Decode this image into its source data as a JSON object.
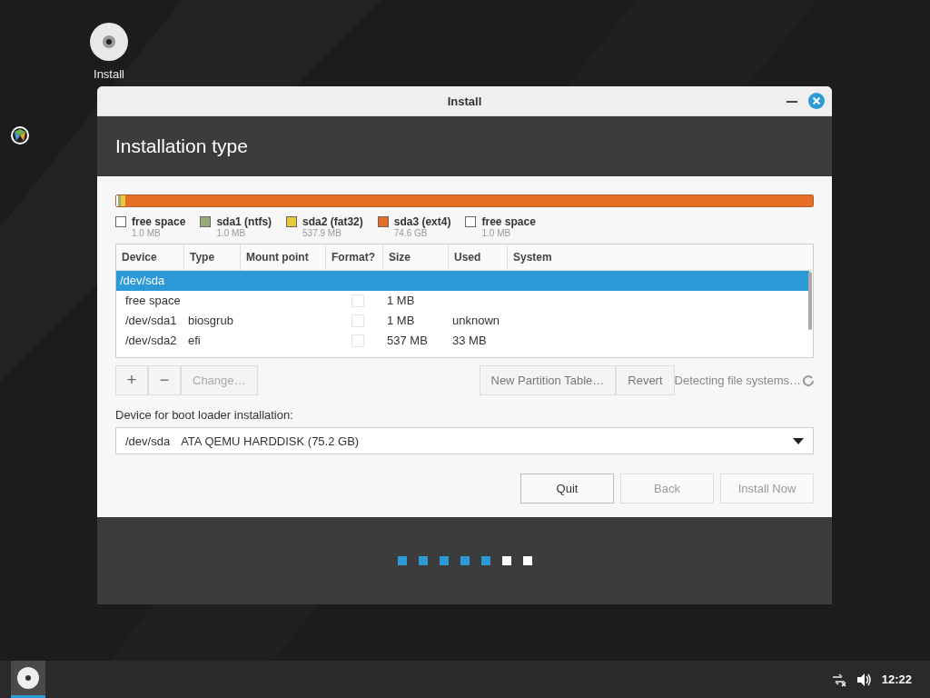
{
  "desktop_icons": [
    {
      "label": "Install"
    }
  ],
  "window": {
    "title": "Install"
  },
  "header": {
    "title": "Installation type"
  },
  "legend": [
    {
      "label": "free space",
      "size": "1.0 MB",
      "color": "#ffffff",
      "level": 0.003
    },
    {
      "label": "sda1 (ntfs)",
      "size": "1.0 MB",
      "color": "#9aab7a",
      "level": 0.003
    },
    {
      "label": "sda2 (fat32)",
      "size": "537.9 MB",
      "color": "#e8c93a",
      "level": 0.007
    },
    {
      "label": "sda3 (ext4)",
      "size": "74.6 GB",
      "color": "#e66e25",
      "level": 0.987
    },
    {
      "label": "free space",
      "size": "1.0 MB",
      "color": "#ffffff"
    }
  ],
  "table": {
    "columns": [
      "Device",
      "Type",
      "Mount point",
      "Format?",
      "Size",
      "Used",
      "System"
    ],
    "rows": [
      {
        "kind": "disk",
        "selected": true,
        "device": "/dev/sda"
      },
      {
        "kind": "partition",
        "selected": false,
        "device": "free space",
        "format": false,
        "size": "1 MB"
      },
      {
        "kind": "partition",
        "selected": false,
        "device": "/dev/sda1",
        "type": "biosgrub",
        "format": false,
        "size": "1 MB",
        "used": "unknown"
      },
      {
        "kind": "partition",
        "selected": false,
        "device": "/dev/sda2",
        "type": "efi",
        "format": false,
        "size": "537 MB",
        "used": "33 MB"
      }
    ]
  },
  "partition_tools": {
    "add": "+",
    "remove": "−",
    "change": {
      "label": "Change…",
      "disabled": true
    },
    "new_table": {
      "label": "New Partition Table…",
      "disabled": false
    },
    "revert": {
      "label": "Revert",
      "disabled": false
    },
    "status": "Detecting file systems…"
  },
  "boot_loader": {
    "label": "Device for boot loader installation:",
    "device": "/dev/sda",
    "description": "ATA QEMU HARDDISK (75.2 GB)"
  },
  "buttons": [
    {
      "label": "Quit",
      "disabled": false
    },
    {
      "label": "Back",
      "disabled": true
    },
    {
      "label": "Install Now",
      "disabled": true
    }
  ],
  "steps": [
    {
      "done": true
    },
    {
      "done": true
    },
    {
      "done": true
    },
    {
      "done": true
    },
    {
      "done": true
    },
    {
      "done": false
    },
    {
      "done": false
    }
  ],
  "taskbar": {
    "clock": "12:22"
  }
}
